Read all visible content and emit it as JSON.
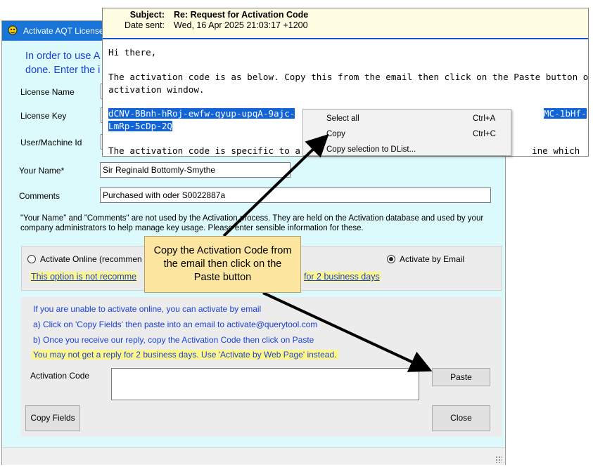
{
  "dialog": {
    "title": "Activate AQT License",
    "intro_line1": "In order to use A",
    "intro_line2": "done. Enter the i",
    "labels": {
      "license_name": "License Name",
      "license_key": "License Key",
      "user_machine_id": "User/Machine Id",
      "your_name": "Your Name*",
      "comments": "Comments"
    },
    "fields": {
      "your_name": "Sir Reginald Bottomly-Smythe",
      "comments": "Purchased with oder S0022887a"
    },
    "note_line1": "\"Your Name\" and \"Comments\" are not used by the Activation process. They are held on the Activation database and used by your",
    "note_line2": "company administrators to help manage key usage. Please enter sensible information for these.",
    "options": {
      "online_label": "Activate Online (recommen",
      "email_label": "Activate by Email",
      "selected": "email"
    },
    "warning_left": "This option is not recomme",
    "warning_right": "for 2 business days",
    "email_instructions": {
      "line1": "If you are unable to activate online, you can activate by email",
      "line2": "a) Click on 'Copy Fields' then paste into an email to activate@querytool.com",
      "line3": "b) Once you receive our reply, copy the Activation Code then click on Paste",
      "line4": "You may not get a reply for 2 business days. Use 'Activate by Web Page' instead."
    },
    "activation_code_label": "Activation Code",
    "activation_code_value": "",
    "buttons": {
      "paste": "Paste",
      "copy_fields": "Copy Fields",
      "close": "Close"
    }
  },
  "email": {
    "subject_label": "Subject:",
    "subject": "Re: Request for Activation Code",
    "date_label": "Date sent:",
    "date": "Wed, 16 Apr 2025 21:03:17 +1200",
    "greeting": "Hi there,",
    "body_line1": "The activation code is as below. Copy this from the email then click on the Paste button on the",
    "body_line2": "activation window.",
    "code_part1": "dCNV-BBnh-hRoj-ewfw-qyup-upqA-9ajc-",
    "code_part1_end": "MC-1bHf-",
    "code_part2": "LmRp-5cDp-2Q",
    "body_line3_left": "The activation code is specific to a machi",
    "body_line3_right": "ine which"
  },
  "context_menu": {
    "items": [
      {
        "label": "Select all",
        "shortcut": "Ctrl+A"
      },
      {
        "label": "Copy",
        "shortcut": "Ctrl+C"
      },
      {
        "label": "Copy selection to DList...",
        "shortcut": ""
      }
    ]
  },
  "callout": {
    "line1": "Copy the Activation Code from",
    "line2": "the email then click on the",
    "line3": "Paste button"
  },
  "colors": {
    "titlebar": "#1874d6",
    "dialog_bg": "#dcf9fb",
    "link_blue": "#1a3fd6",
    "highlight_yellow": "#fdf68a",
    "selection": "#1164d8",
    "callout_bg": "#fde7a0"
  }
}
